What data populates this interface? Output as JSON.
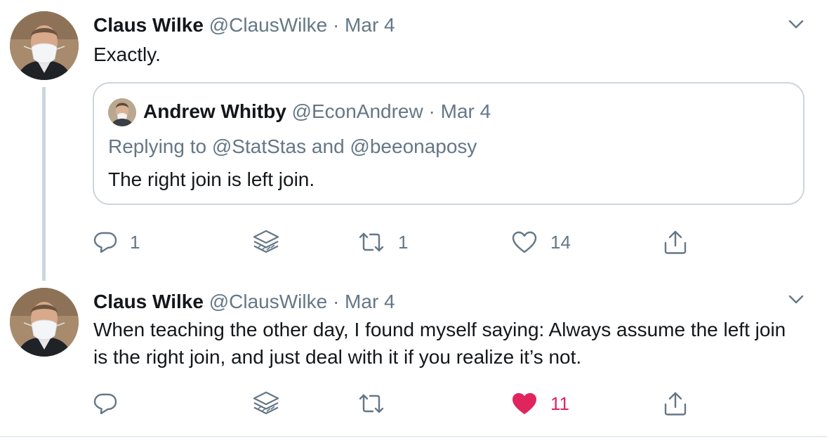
{
  "colors": {
    "text": "#14171a",
    "secondary": "#657786",
    "border": "#ccd6dd",
    "like_active": "#e0245e"
  },
  "tweets": [
    {
      "author_name": "Claus Wilke",
      "handle": "@ClausWilke",
      "separator": "·",
      "date": "Mar 4",
      "text": "Exactly.",
      "quoted": {
        "author_name": "Andrew Whitby",
        "handle": "@EconAndrew",
        "separator": "·",
        "date": "Mar 4",
        "reply_prefix": "Replying to",
        "reply_mention_1": "@StatStas",
        "reply_and": "and",
        "reply_mention_2": "@beeonaposy",
        "text": "The right join is left join."
      },
      "actions": {
        "reply_count": "1",
        "retweet_count": "1",
        "like_count": "14",
        "liked": false
      }
    },
    {
      "author_name": "Claus Wilke",
      "handle": "@ClausWilke",
      "separator": "·",
      "date": "Mar 4",
      "text": "When teaching the other day, I found myself saying: Always assume the left join is the right join, and just deal with it if you realize it’s not.",
      "actions": {
        "reply_count": "",
        "retweet_count": "",
        "like_count": "11",
        "liked": true
      }
    }
  ],
  "icons": {
    "reply": "reply-bubble-icon",
    "layers": "layers-icon",
    "retweet": "retweet-icon",
    "like": "heart-icon",
    "share": "share-icon",
    "caret": "chevron-down-icon"
  }
}
